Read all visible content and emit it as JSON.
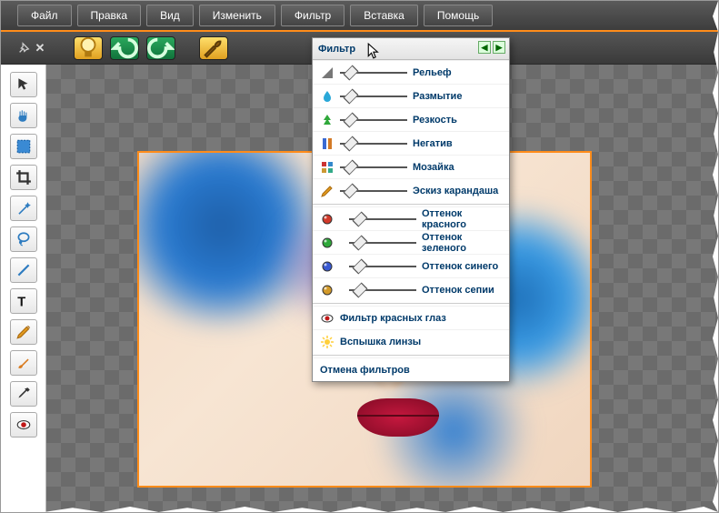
{
  "menu": {
    "items": [
      "Файл",
      "Правка",
      "Вид",
      "Изменить",
      "Фильтр",
      "Вставка",
      "Помощь"
    ]
  },
  "toolbar": {
    "pin_icon": "pin-icon",
    "close_icon": "close-icon",
    "bulb_icon": "bulb-icon",
    "undo_icon": "undo-icon",
    "redo_icon": "redo-icon",
    "wrench_icon": "wrench-icon"
  },
  "left_tools": [
    {
      "name": "pointer-tool",
      "color": "#333"
    },
    {
      "name": "hand-tool",
      "color": "#2e7cc0"
    },
    {
      "name": "selection-tool",
      "color": "#1266c4"
    },
    {
      "name": "crop-tool",
      "color": "#333"
    },
    {
      "name": "magic-wand-tool",
      "color": "#2e7cc0"
    },
    {
      "name": "lasso-tool",
      "color": "#2e7cc0"
    },
    {
      "name": "line-tool",
      "color": "#2e7cc0"
    },
    {
      "name": "text-tool",
      "color": "#111"
    },
    {
      "name": "pencil-tool",
      "color": "#e29a1e"
    },
    {
      "name": "brush-tool",
      "color": "#d97a1e"
    },
    {
      "name": "eyedropper-tool",
      "color": "#333"
    },
    {
      "name": "redeye-tool",
      "color": "#c01818"
    }
  ],
  "filter_panel": {
    "title": "Фильтр",
    "rows_slider": [
      {
        "icon": "emboss-icon",
        "label": "Рельеф",
        "color": "#777"
      },
      {
        "icon": "drop-icon",
        "label": "Размытие",
        "color": "#2aa8d8"
      },
      {
        "icon": "tree-icon",
        "label": "Резкость",
        "color": "#2fa83a"
      },
      {
        "icon": "negative-icon",
        "label": "Негатив",
        "color": "#d37a26"
      },
      {
        "icon": "mosaic-icon",
        "label": "Мозайка",
        "color": "#a02626"
      },
      {
        "icon": "pencil-sketch-icon",
        "label": "Эскиз карандаша",
        "color": "#e29a1e"
      }
    ],
    "rows_color": [
      {
        "icon": "red-dot-icon",
        "label": "Оттенок красного",
        "color": "#d23a2a"
      },
      {
        "icon": "green-dot-icon",
        "label": "Оттенок зеленого",
        "color": "#2fa83a"
      },
      {
        "icon": "blue-dot-icon",
        "label": "Оттенок синего",
        "color": "#3a5ad2"
      },
      {
        "icon": "sepia-dot-icon",
        "label": "Оттенок сепии",
        "color": "#d39a2a"
      }
    ],
    "rows_action": [
      {
        "icon": "redeye-icon",
        "label": "Фильтр красных глаз"
      },
      {
        "icon": "lensflare-icon",
        "label": "Вспышка линзы"
      }
    ],
    "cancel": "Отмена фильтров"
  }
}
